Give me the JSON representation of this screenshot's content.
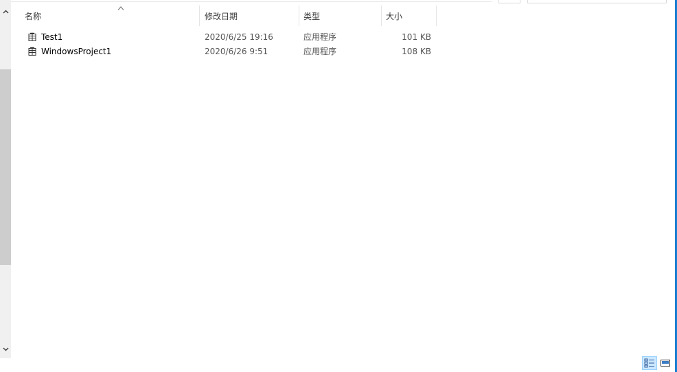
{
  "columns": {
    "name": "名称",
    "date": "修改日期",
    "type": "类型",
    "size": "大小"
  },
  "files": [
    {
      "name": "Test1",
      "date": "2020/6/25 19:16",
      "type": "应用程序",
      "size": "101 KB",
      "icon": "application-icon"
    },
    {
      "name": "WindowsProject1",
      "date": "2020/6/26 9:51",
      "type": "应用程序",
      "size": "108 KB",
      "icon": "application-icon"
    }
  ],
  "sort": {
    "column": "name",
    "direction": "ascending"
  },
  "view_buttons": [
    {
      "icon": "details-view-icon",
      "active": true
    },
    {
      "icon": "large-icons-view-icon",
      "active": false
    }
  ],
  "colors": {
    "accent": "#1a7fd1",
    "header_text": "#3a3a3a",
    "selected_view_bg": "#cce8ff"
  }
}
